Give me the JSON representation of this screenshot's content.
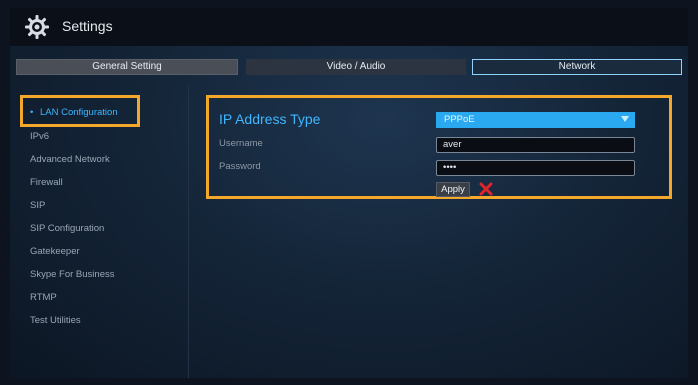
{
  "window": {
    "title": "Settings"
  },
  "tabs": [
    {
      "label": "General Setting"
    },
    {
      "label": "Video / Audio"
    },
    {
      "label": "Network"
    }
  ],
  "sidebar": {
    "items": [
      {
        "label": "LAN Configuration",
        "active": true
      },
      {
        "label": "IPv6"
      },
      {
        "label": "Advanced Network"
      },
      {
        "label": "Firewall"
      },
      {
        "label": "SIP"
      },
      {
        "label": "SIP Configuration"
      },
      {
        "label": "Gatekeeper"
      },
      {
        "label": "Skype For Business"
      },
      {
        "label": "RTMP"
      },
      {
        "label": "Test Utilities"
      }
    ],
    "active_marker": "•"
  },
  "lan": {
    "ip_type_label": "IP Address Type",
    "ip_type_value": "PPPoE",
    "username_label": "Username",
    "username_value": "aver",
    "password_label": "Password",
    "password_value": "••••",
    "apply_label": "Apply"
  },
  "icons": {
    "settings": "gear-icon",
    "dropdown": "caret-down-icon",
    "cancel": "close-icon"
  },
  "colors": {
    "accent": "#3fb7ff",
    "highlight": "#f3a82c",
    "dropdown": "#2aa9f0",
    "cancel": "#e0242a"
  }
}
